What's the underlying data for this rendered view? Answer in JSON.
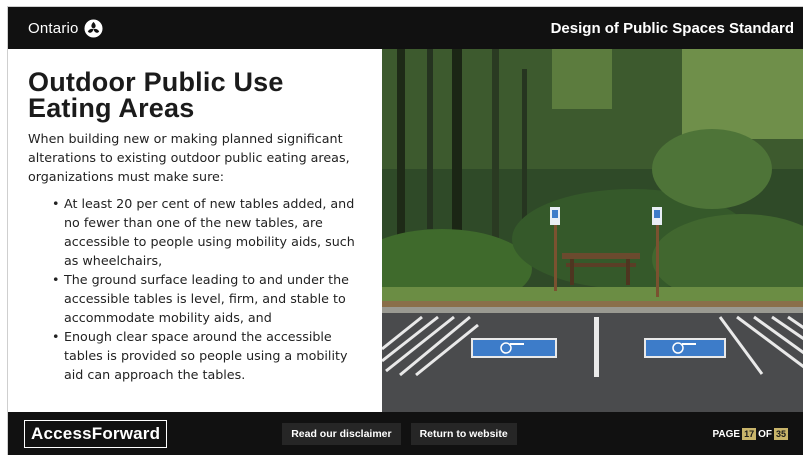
{
  "header": {
    "brand": "Ontario",
    "brand_icon": "trillium-logo-icon",
    "document_title": "Design of Public Spaces Standard"
  },
  "content": {
    "heading": "Outdoor Public Use Eating Areas",
    "intro": "When building new or making planned significant alterations to existing outdoor public eating areas, organizations must make sure:",
    "bullets": [
      "At least 20 per cent of new tables added, and no fewer than one of the new tables, are accessible to people using mobility aids, such as wheelchairs,",
      "The ground surface leading to and under the accessible tables is level, firm, and stable to accommodate mobility aids, and",
      "Enough clear space around the accessible tables is provided so people using a mobility aid can approach the tables."
    ]
  },
  "footer": {
    "logo": "AccessForward",
    "disclaimer_label": "Read our disclaimer",
    "return_label": "Return to website",
    "page_label": "PAGE",
    "page_current": "17",
    "page_of": "OF",
    "page_total": "35"
  },
  "colors": {
    "bar": "#111111",
    "button": "#262626",
    "page_box": "#c8b46a",
    "accessible_blue": "#3d7cc9"
  }
}
